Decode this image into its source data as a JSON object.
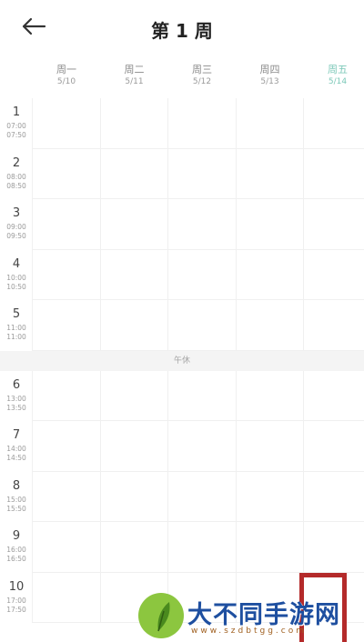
{
  "header": {
    "title": "第 1 周",
    "back_icon": "arrow-left-icon"
  },
  "days": [
    {
      "name": "周一",
      "date": "5/10",
      "today": false
    },
    {
      "name": "周二",
      "date": "5/11",
      "today": false
    },
    {
      "name": "周三",
      "date": "5/12",
      "today": false
    },
    {
      "name": "周四",
      "date": "5/13",
      "today": false
    },
    {
      "name": "周五",
      "date": "5/14",
      "today": true
    }
  ],
  "periods": [
    {
      "num": "1",
      "start": "07:00",
      "end": "07:50"
    },
    {
      "num": "2",
      "start": "08:00",
      "end": "08:50"
    },
    {
      "num": "3",
      "start": "09:00",
      "end": "09:50"
    },
    {
      "num": "4",
      "start": "10:00",
      "end": "10:50"
    },
    {
      "num": "5",
      "start": "11:00",
      "end": "11:00"
    },
    {
      "num": "6",
      "start": "13:00",
      "end": "13:50"
    },
    {
      "num": "7",
      "start": "14:00",
      "end": "14:50"
    },
    {
      "num": "8",
      "start": "15:00",
      "end": "15:50"
    },
    {
      "num": "9",
      "start": "16:00",
      "end": "16:50"
    },
    {
      "num": "10",
      "start": "17:00",
      "end": "17:50"
    }
  ],
  "noon_label": "午休",
  "watermark": {
    "text": "大不同手游网",
    "url": "www.szdbtgg.com"
  },
  "colors": {
    "today": "#7cc8b8",
    "event_border": "#b42a2a"
  }
}
